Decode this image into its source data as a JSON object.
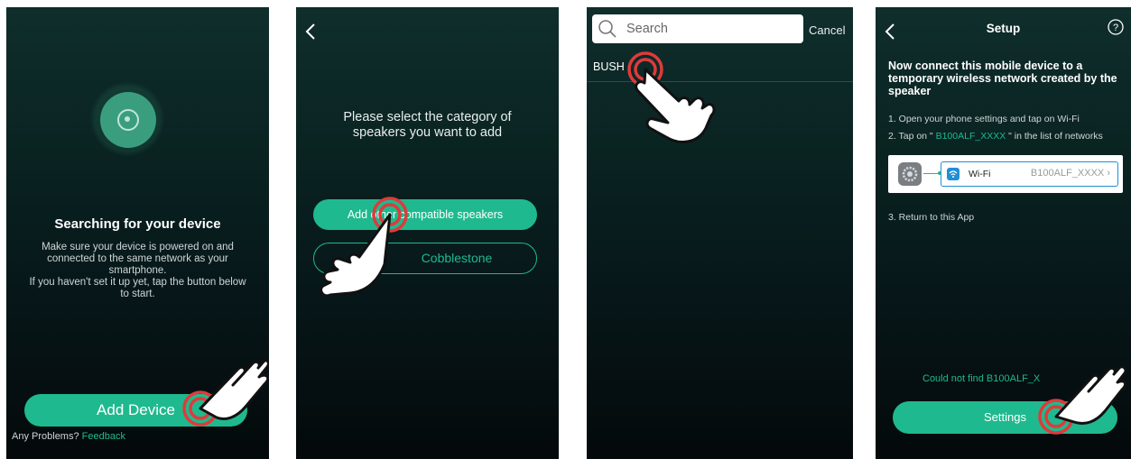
{
  "screen1": {
    "title": "Searching for your device",
    "description": [
      "Make sure your device is powered on and",
      "connected to the same network as your",
      "smartphone.",
      "If you haven't set it up yet, tap the button below",
      "to start."
    ],
    "add_device_label": "Add Device",
    "problems_text": "Any Problems?",
    "feedback_link": "Feedback"
  },
  "screen2": {
    "title_line1": "Please select the category of",
    "title_line2": "speakers you want to add",
    "button_primary": "Add other    compatible speakers",
    "button_secondary": "Cobblestone"
  },
  "screen3": {
    "search_placeholder": "Search",
    "cancel_label": "Cancel",
    "result_item": "BUSH"
  },
  "screen4": {
    "title": "Setup",
    "heading": "Now connect this mobile device to a temporary wireless network created by the speaker",
    "step1": "1. Open your phone settings and tap on Wi-Fi",
    "step2_prefix": "2. Tap on \"",
    "step2_network": " B100ALF_XXXX ",
    "step2_suffix": "\" in the list of networks",
    "wifi_label": "Wi-Fi",
    "wifi_value": "B100ALF_XXXX",
    "step3": "3. Return to this App",
    "not_found_text": "Could not find B100ALF_X",
    "settings_label": "Settings"
  },
  "colors": {
    "accent": "#1fb98f",
    "screen_top": "#0f2e2c",
    "screen_bottom": "#04090b",
    "tap_ring": "#e03a3a"
  }
}
